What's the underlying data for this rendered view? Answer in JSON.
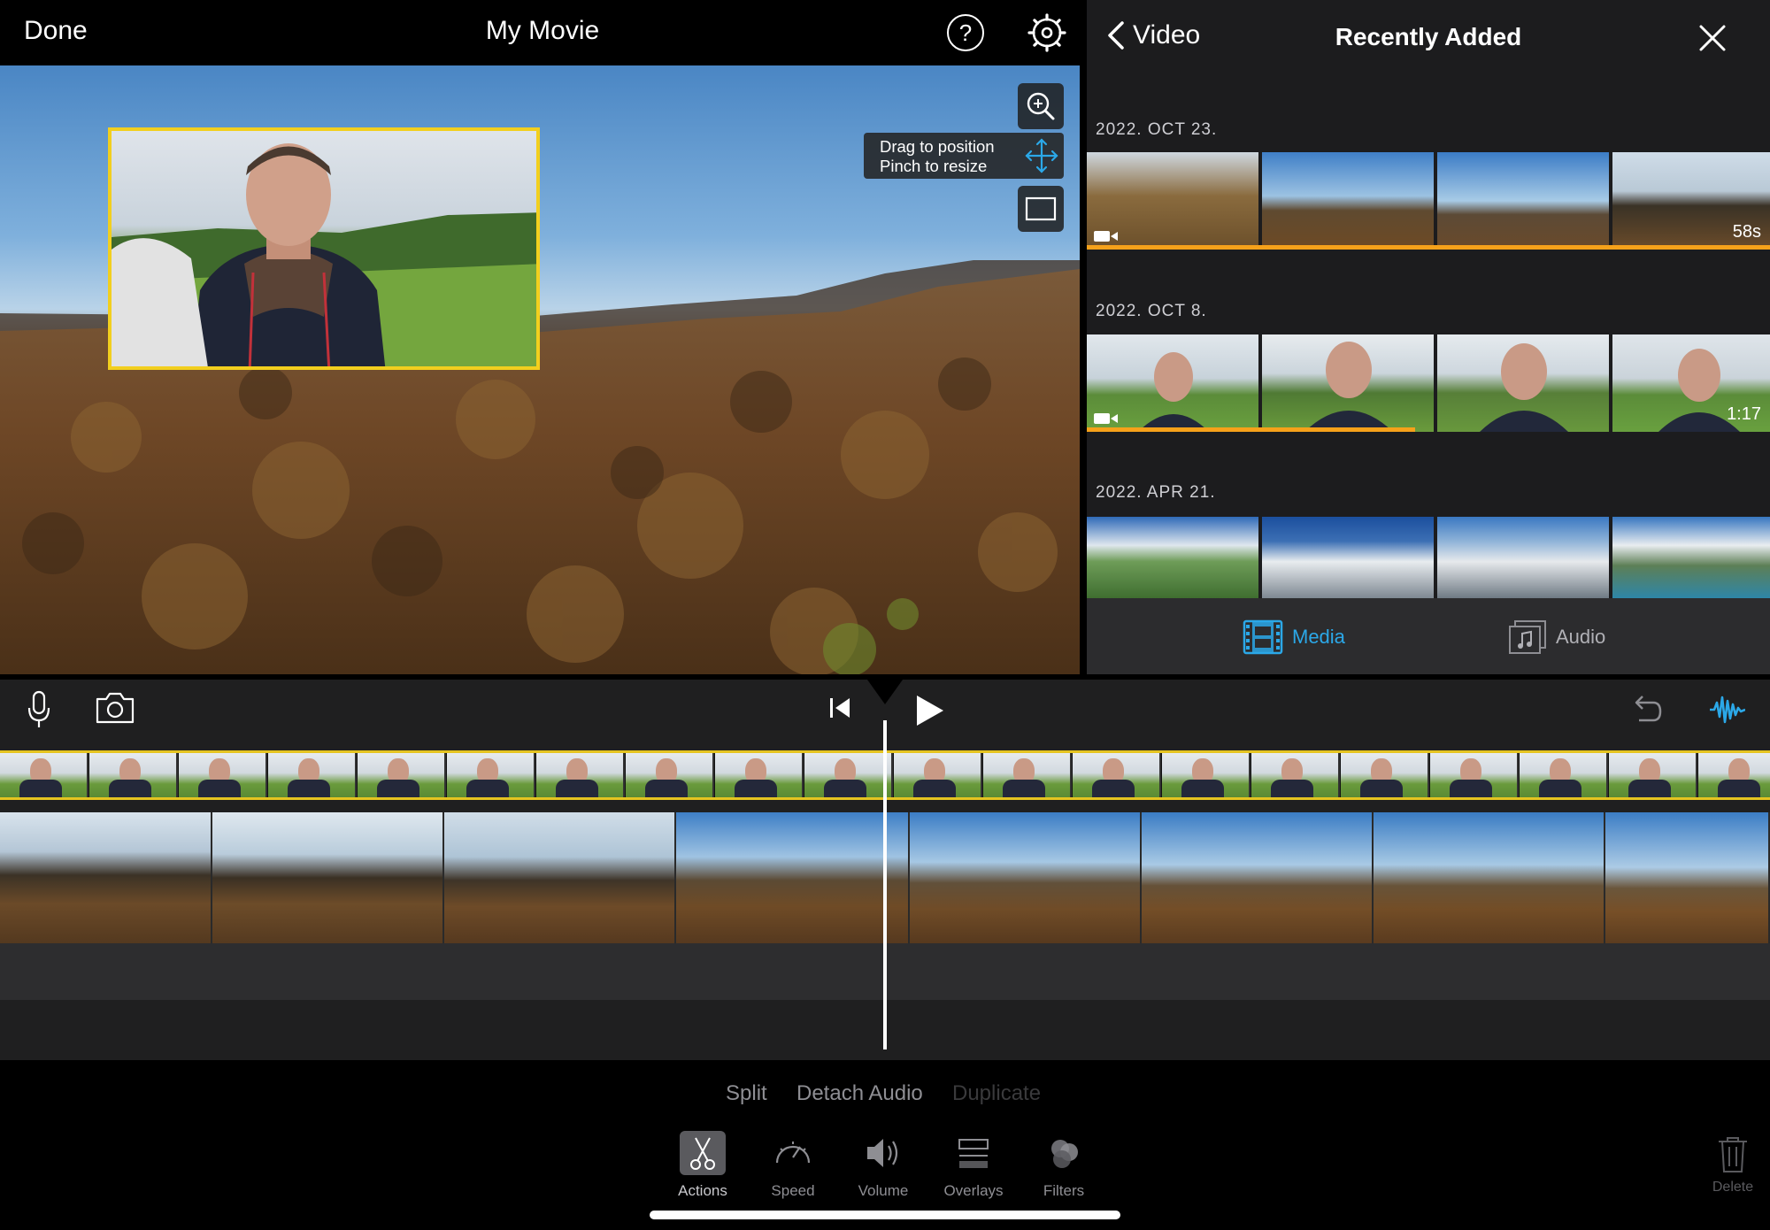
{
  "topbar": {
    "done_label": "Done",
    "title": "My Movie",
    "help_label": "?"
  },
  "viewer": {
    "hint_line1": "Drag to position",
    "hint_line2": "Pinch to resize"
  },
  "media_panel": {
    "back_label": "Video",
    "title": "Recently Added",
    "groups": [
      {
        "date": "2022. OCT 23.",
        "duration": "58s",
        "progress": 1.0
      },
      {
        "date": "2022. OCT 8.",
        "duration": "1:17",
        "progress": 0.48
      },
      {
        "date": "2022. APR 21.",
        "duration": "",
        "progress": 0
      }
    ],
    "tabs": [
      {
        "label": "Media",
        "active": true
      },
      {
        "label": "Audio",
        "active": false
      }
    ]
  },
  "actions": {
    "split": "Split",
    "detach_audio": "Detach Audio",
    "duplicate": "Duplicate"
  },
  "tools": [
    {
      "label": "Actions",
      "icon": "scissors-icon",
      "selected": true
    },
    {
      "label": "Speed",
      "icon": "speedometer-icon",
      "selected": false
    },
    {
      "label": "Volume",
      "icon": "speaker-icon",
      "selected": false
    },
    {
      "label": "Overlays",
      "icon": "overlays-icon",
      "selected": false
    },
    {
      "label": "Filters",
      "icon": "filters-icon",
      "selected": false
    }
  ],
  "delete_label": "Delete",
  "colors": {
    "accent_blue": "#2ba8e8",
    "pip_border": "#f2cf1e",
    "progress_orange": "#f6a11a"
  }
}
